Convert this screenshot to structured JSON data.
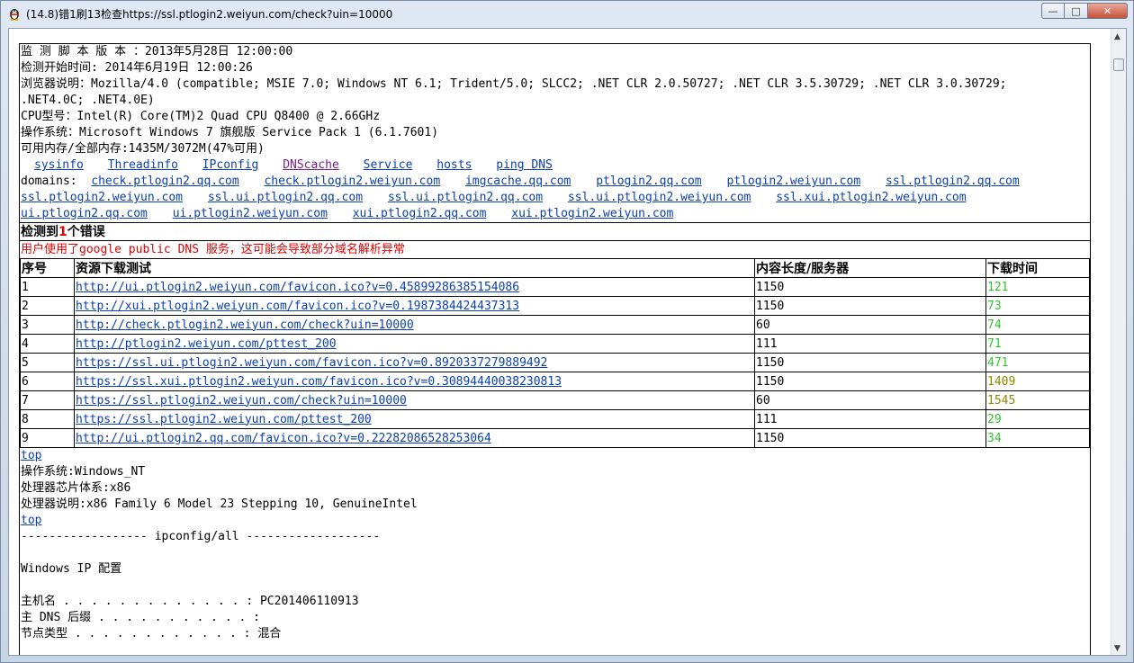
{
  "window": {
    "title": "(14.8)错1刷13检查https://ssl.ptlogin2.weiyun.com/check?uin=10000",
    "close_label": "✕",
    "max_label": "□",
    "min_label": "—"
  },
  "info": [
    "监 测 脚 本 版 本 ：2013年5月28日 12:00:00",
    "检测开始时间: 2014年6月19日 12:00:26",
    "浏览器说明：Mozilla/4.0 (compatible; MSIE 7.0; Windows NT 6.1; Trident/5.0; SLCC2; .NET CLR 2.0.50727; .NET CLR 3.5.30729; .NET CLR 3.0.30729;",
    ".NET4.0C; .NET4.0E)",
    "CPU型号：Intel(R) Core(TM)2 Quad CPU Q8400 @ 2.66GHz",
    "操作系统：Microsoft Windows 7 旗舰版 Service Pack 1 (6.1.7601)",
    "可用内存/全部内存:1435M/3072M(47%可用)"
  ],
  "nav": [
    "sysinfo",
    "Threadinfo",
    "IPconfig",
    "DNScache",
    "Service",
    "hosts",
    "ping DNS"
  ],
  "domains_label": "domains:",
  "domains_row1": [
    "check.ptlogin2.qq.com",
    "check.ptlogin2.weiyun.com",
    "imgcache.qq.com",
    "ptlogin2.qq.com",
    "ptlogin2.weiyun.com",
    "ssl.ptlogin2.qq.com"
  ],
  "domains_row2": [
    "ssl.ptlogin2.weiyun.com",
    "ssl.ui.ptlogin2.qq.com",
    "ssl.ui.ptlogin2.qq.com",
    "ssl.ui.ptlogin2.weiyun.com",
    "ssl.xui.ptlogin2.weiyun.com"
  ],
  "domains_row3": [
    "ui.ptlogin2.qq.com",
    "ui.ptlogin2.weiyun.com",
    "xui.ptlogin2.qq.com",
    "xui.ptlogin2.weiyun.com"
  ],
  "errors": {
    "prefix": "检测到",
    "count": "1",
    "suffix": "个错误",
    "message": "用户使用了google public DNS 服务，这可能会导致部分域名解析异常"
  },
  "table": {
    "headers": [
      "序号",
      "资源下载测试",
      "内容长度/服务器",
      "下载时间"
    ],
    "rows": [
      {
        "n": "1",
        "url": "http://ui.ptlogin2.weiyun.com/favicon.ico?v=0.45899286385154086",
        "len": "1150",
        "time": "121",
        "tone": "green"
      },
      {
        "n": "2",
        "url": "http://xui.ptlogin2.weiyun.com/favicon.ico?v=0.1987384424437313",
        "len": "1150",
        "time": "73",
        "tone": "green"
      },
      {
        "n": "3",
        "url": "http://check.ptlogin2.weiyun.com/check?uin=10000",
        "len": "60",
        "time": "74",
        "tone": "green"
      },
      {
        "n": "4",
        "url": "http://ptlogin2.weiyun.com/pttest_200",
        "len": "111",
        "time": "71",
        "tone": "green"
      },
      {
        "n": "5",
        "url": "https://ssl.ui.ptlogin2.weiyun.com/favicon.ico?v=0.8920337279889492",
        "len": "1150",
        "time": "471",
        "tone": "green"
      },
      {
        "n": "6",
        "url": "https://ssl.xui.ptlogin2.weiyun.com/favicon.ico?v=0.30894440038230813",
        "len": "1150",
        "time": "1409",
        "tone": "olive"
      },
      {
        "n": "7",
        "url": "https://ssl.ptlogin2.weiyun.com/check?uin=10000",
        "len": "60",
        "time": "1545",
        "tone": "olive"
      },
      {
        "n": "8",
        "url": "https://ssl.ptlogin2.weiyun.com/pttest_200",
        "len": "111",
        "time": "29",
        "tone": "green"
      },
      {
        "n": "9",
        "url": "http://ui.ptlogin2.qq.com/favicon.ico?v=0.22282086528253064",
        "len": "1150",
        "time": "34",
        "tone": "green"
      }
    ]
  },
  "top_label": "top",
  "sysinfo": [
    "操作系统:Windows_NT",
    "处理器芯片体系:x86",
    "处理器说明:x86 Family 6 Model 23 Stepping 10, GenuineIntel"
  ],
  "ipconfig": {
    "header": "------------------ ipconfig/all -------------------",
    "title": "Windows IP 配置",
    "lines": [
      "主机名 . . . . . . . . . . . . . : PC201406110913",
      "主 DNS 后缀 . . . . . . . . . . . :",
      "节点类型 . . . . . . . . . . . . : 混合"
    ]
  }
}
